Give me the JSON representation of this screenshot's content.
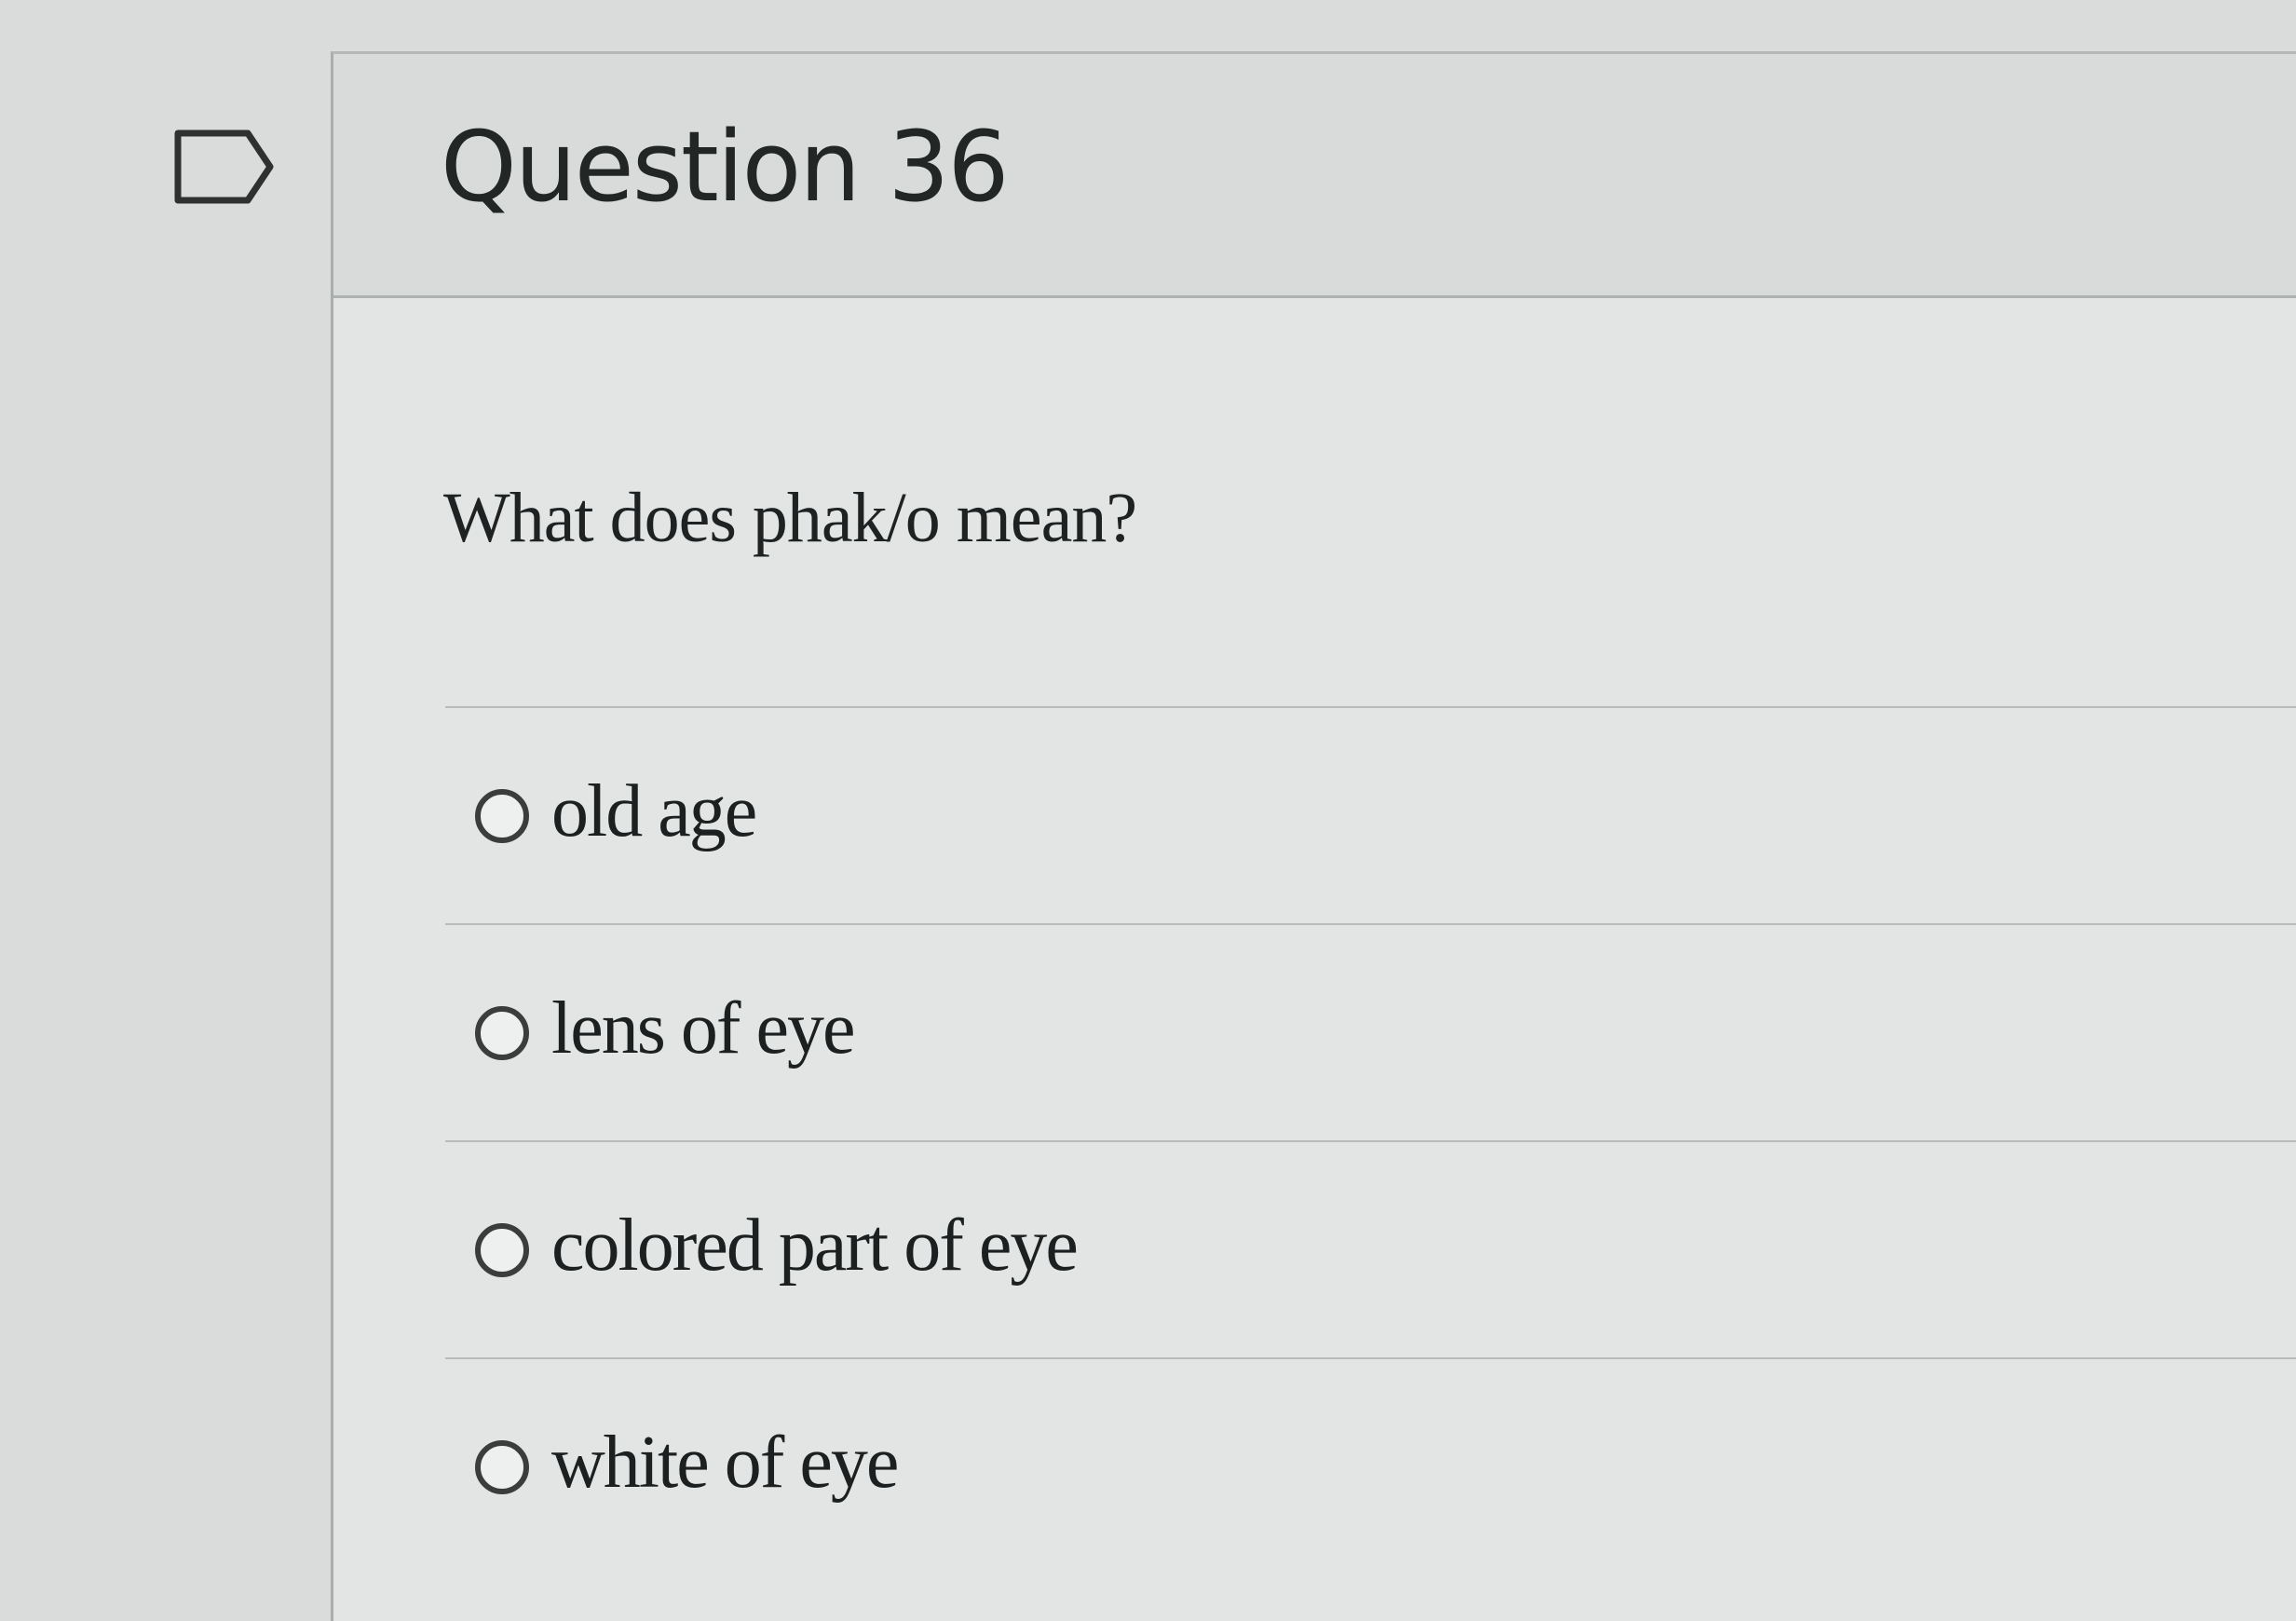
{
  "question": {
    "title": "Question 36",
    "text": "What does phak/o mean?",
    "answers": [
      {
        "label": "old age",
        "selected": false
      },
      {
        "label": "lens of eye",
        "selected": false
      },
      {
        "label": "colored part of eye",
        "selected": false
      },
      {
        "label": "white of eye",
        "selected": false
      }
    ]
  },
  "icons": {
    "flag": "flag-outline-icon",
    "radio": "radio-unchecked-icon"
  }
}
